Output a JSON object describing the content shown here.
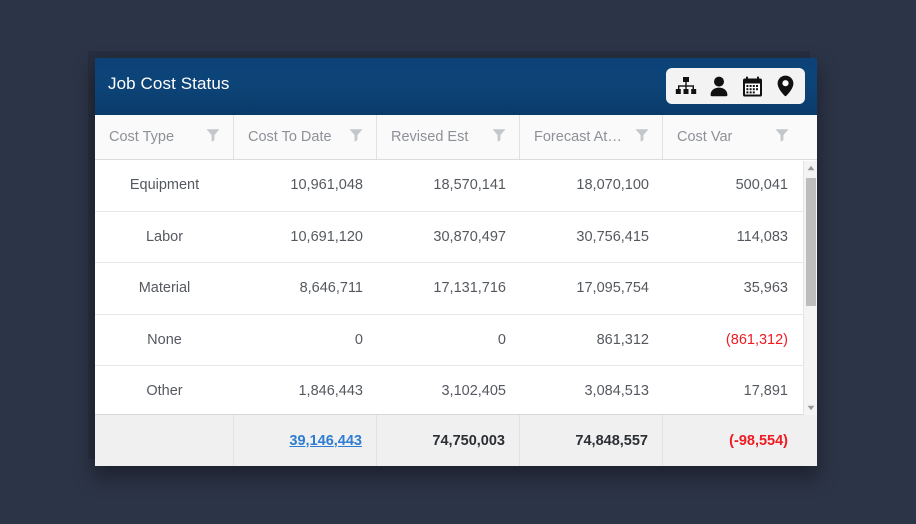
{
  "window": {
    "background_color": "#2c3447"
  },
  "panel": {
    "title": "Job Cost Status",
    "header_color": "#0d4478",
    "toolbar": {
      "icons": [
        {
          "name": "org-chart-icon",
          "label": "Org Chart"
        },
        {
          "name": "person-icon",
          "label": "Person"
        },
        {
          "name": "calendar-icon",
          "label": "Calendar"
        },
        {
          "name": "location-pin-icon",
          "label": "Location"
        }
      ]
    }
  },
  "table": {
    "columns": [
      {
        "label": "Cost Type",
        "filter": "filter-icon"
      },
      {
        "label": "Cost To Date",
        "filter": "filter-icon"
      },
      {
        "label": "Revised Est",
        "filter": "filter-icon"
      },
      {
        "label": "Forecast At…",
        "filter": "filter-icon"
      },
      {
        "label": "Cost Var",
        "filter": "filter-icon"
      }
    ],
    "rows": [
      {
        "cost_type": "Equipment",
        "cost_to_date": "10,961,048",
        "revised_est": "18,570,141",
        "forecast_at": "18,070,100",
        "cost_var": "500,041",
        "cost_var_negative": false
      },
      {
        "cost_type": "Labor",
        "cost_to_date": "10,691,120",
        "revised_est": "30,870,497",
        "forecast_at": "30,756,415",
        "cost_var": "114,083",
        "cost_var_negative": false
      },
      {
        "cost_type": "Material",
        "cost_to_date": "8,646,711",
        "revised_est": "17,131,716",
        "forecast_at": "17,095,754",
        "cost_var": "35,963",
        "cost_var_negative": false
      },
      {
        "cost_type": "None",
        "cost_to_date": "0",
        "revised_est": "0",
        "forecast_at": "861,312",
        "cost_var": "(861,312)",
        "cost_var_negative": true
      },
      {
        "cost_type": "Other",
        "cost_to_date": "1,846,443",
        "revised_est": "3,102,405",
        "forecast_at": "3,084,513",
        "cost_var": "17,891",
        "cost_var_negative": false
      }
    ],
    "total": {
      "cost_type": "",
      "cost_to_date": "39,146,443",
      "revised_est": "74,750,003",
      "forecast_at": "74,848,557",
      "cost_var": "(-98,554)",
      "link_color": "#2e7dd1",
      "negative_color": "#ee1b23"
    }
  }
}
